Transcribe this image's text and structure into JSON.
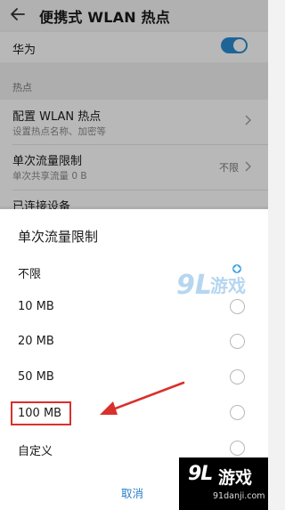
{
  "header": {
    "title": "便携式 WLAN 热点"
  },
  "device": {
    "name": "华为",
    "hotspot_on": true
  },
  "section": {
    "label": "热点"
  },
  "items": [
    {
      "title": "配置 WLAN 热点",
      "subtitle": "设置热点名称、加密等"
    },
    {
      "title": "单次流量限制",
      "subtitle": "单次共享流量 0 B",
      "value": "不限"
    },
    {
      "title": "已连接设备"
    }
  ],
  "dialog": {
    "title": "单次流量限制",
    "options": [
      {
        "label": "不限",
        "selected": true
      },
      {
        "label": "10 MB",
        "selected": false
      },
      {
        "label": "20 MB",
        "selected": false
      },
      {
        "label": "50 MB",
        "selected": false
      },
      {
        "label": "100 MB",
        "selected": false
      },
      {
        "label": "自定义",
        "selected": false
      }
    ],
    "cancel_label": "取消"
  },
  "watermark": {
    "brand_num": "9L",
    "brand_text": "游戏",
    "url": "91danji.com"
  },
  "colors": {
    "accent": "#2a8dd1",
    "annotation": "#d9302c"
  }
}
